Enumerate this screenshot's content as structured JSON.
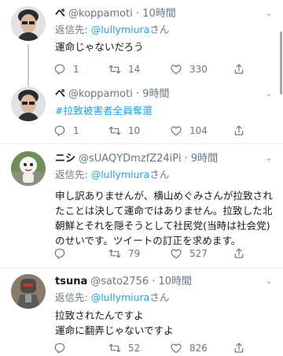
{
  "tweets": [
    {
      "name": "ペ",
      "handle": "@koppamoti",
      "time": "10時間",
      "reply_prefix": "返信先:",
      "reply_handle": "@lullymiura",
      "reply_suffix": "さん",
      "lines": [
        "運命じゃないだろう"
      ],
      "replies": "1",
      "retweets": "14",
      "likes": "330"
    },
    {
      "name": "ペ",
      "handle": "@koppamoti",
      "time": "9時間",
      "lines": [
        "#拉致被害者全員奪還"
      ],
      "replies": "1",
      "retweets": "10",
      "likes": "104"
    },
    {
      "name": "ニシ",
      "handle": "@sUAQYDmzfZ24iPi",
      "time": "9時間",
      "reply_prefix": "返信先:",
      "reply_handle": "@lullymiura",
      "reply_suffix": "さん",
      "lines": [
        "申し訳ありませんが、横山めぐみさんが拉致され",
        "たことは決して運命ではありません。拉致した北",
        "朝鮮とそれを隠そうとして社民党(当時は社会党)",
        "のせいです。ツイートの訂正を求めます。"
      ],
      "replies": "",
      "retweets": "79",
      "likes": "527"
    },
    {
      "name": "tsuna",
      "handle": "@sato2756",
      "time": "10時間",
      "reply_prefix": "返信先:",
      "reply_handle": "@lullymiura",
      "reply_suffix": "さん",
      "lines": [
        "拉致されたんですよ",
        "運命に翻弄じゃないですよ"
      ],
      "replies": "",
      "retweets": "52",
      "likes": "826"
    }
  ],
  "icons": [
    "reply-icon",
    "retweet-icon",
    "like-icon",
    "share-icon",
    "chevron-down-icon"
  ],
  "colors": {
    "link": "#1da1f2",
    "meta": "#657786",
    "text": "#14171a",
    "divider": "#e6ecf0",
    "thread_line": "#c4cfd6"
  }
}
